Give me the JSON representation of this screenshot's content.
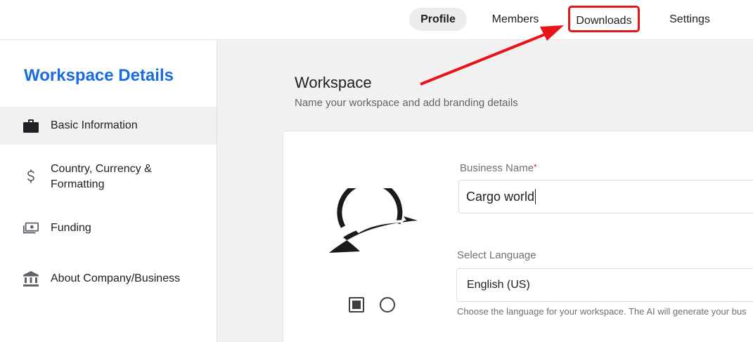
{
  "header": {
    "tabs": [
      {
        "label": "Profile",
        "active": true
      },
      {
        "label": "Members",
        "active": false
      },
      {
        "label": "Downloads",
        "active": false,
        "highlighted": true
      },
      {
        "label": "Settings",
        "active": false
      }
    ]
  },
  "sidebar": {
    "title": "Workspace Details",
    "items": [
      {
        "label": "Basic Information",
        "icon": "briefcase-icon",
        "active": true
      },
      {
        "label": "Country, Currency &",
        "label_line2": "Formatting",
        "icon": "dollar-icon"
      },
      {
        "label": "Funding",
        "icon": "money-icon"
      },
      {
        "label": "About Company/Business",
        "icon": "bank-icon"
      }
    ]
  },
  "main": {
    "title": "Workspace",
    "subtitle": "Name your workspace and add branding details",
    "logo_options": [
      "square-option",
      "circle-option"
    ],
    "business_name": {
      "label": "Business Name",
      "required_mark": "*",
      "value": "Cargo world"
    },
    "language": {
      "label": "Select Language",
      "value": "English (US)",
      "helper": "Choose the language for your workspace. The AI will generate your bus"
    }
  },
  "colors": {
    "accent": "#1a6ae0",
    "annotation": "#e8141c"
  }
}
